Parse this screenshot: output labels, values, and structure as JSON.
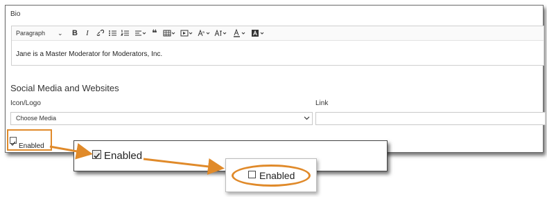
{
  "form": {
    "bio_label": "Bio",
    "toolbar": {
      "paragraph_select": "Paragraph"
    },
    "bio_text": "Jane is a Master Moderator for Moderators, Inc.",
    "section_title": "Social Media and Websites",
    "icon_logo_label": "Icon/Logo",
    "link_label": "Link",
    "media_select": "Choose Media",
    "enabled_label": "Enabled"
  },
  "zoom_checked": {
    "label": "Enabled",
    "checked": true
  },
  "zoom_unchecked": {
    "label": "Enabled",
    "checked": false
  },
  "colors": {
    "highlight": "#e08a2a"
  }
}
